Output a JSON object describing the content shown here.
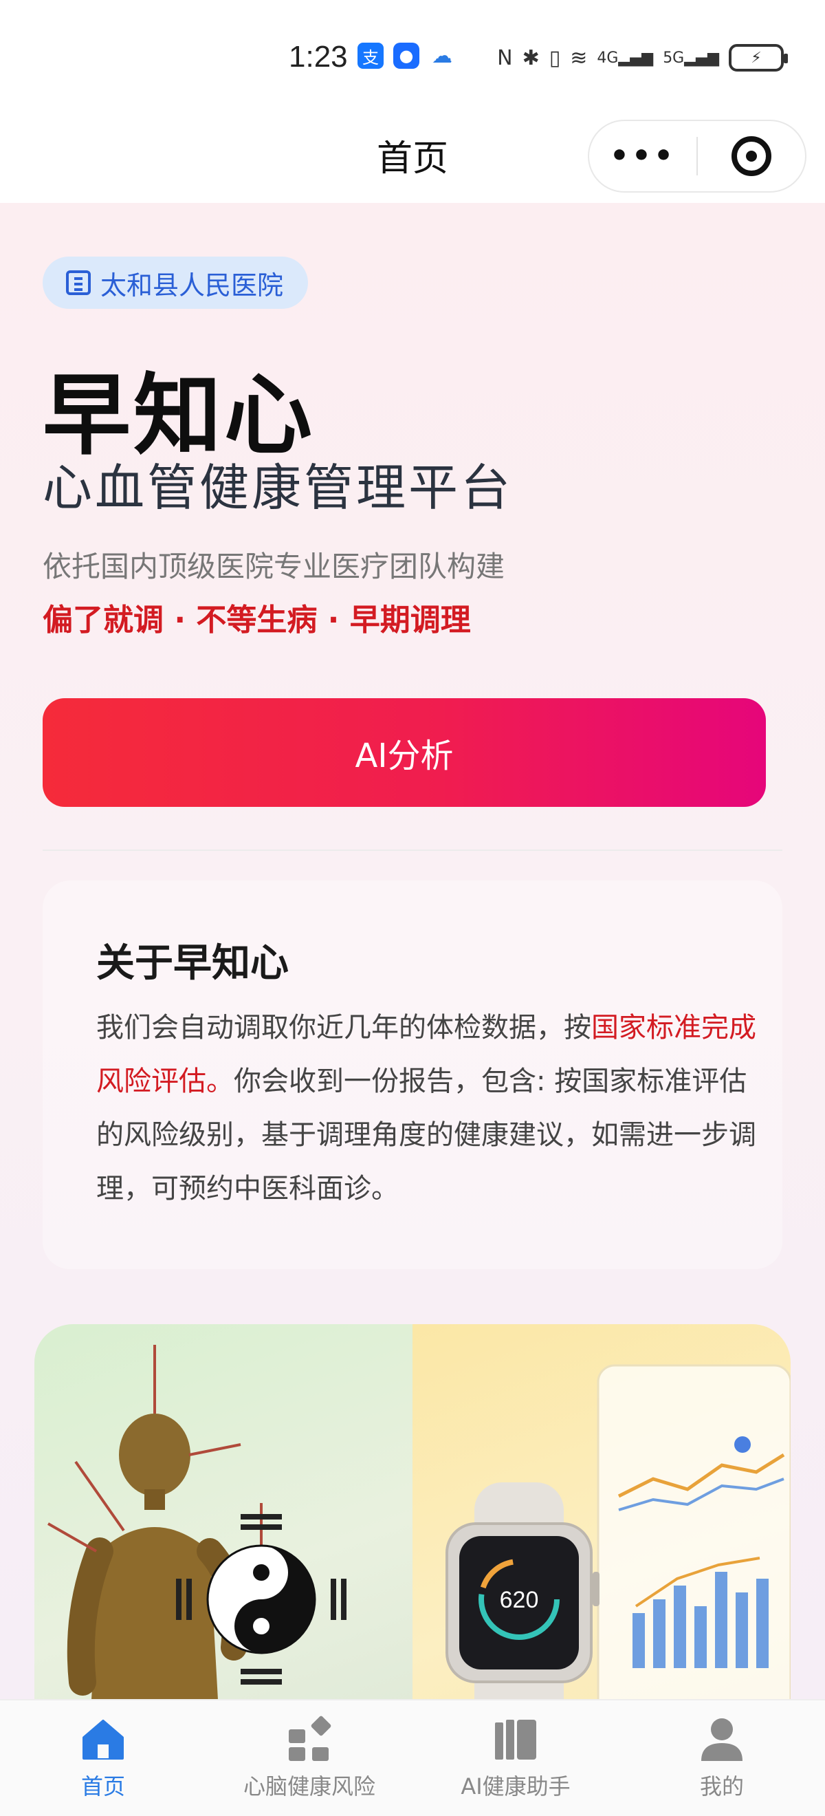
{
  "status": {
    "time": "1:23",
    "network": "4G",
    "network2": "5G"
  },
  "header": {
    "title": "首页",
    "more_icon": "ellipsis-icon",
    "close_icon": "target-icon"
  },
  "hospital": {
    "name": "太和县人民医院",
    "icon": "hospital-icon"
  },
  "hero": {
    "title": "早知心",
    "subtitle": "心血管健康管理平台",
    "description": "依托国内顶级医院专业医疗团队构建",
    "slogan": "偏了就调 · 不等生病 · 早期调理",
    "button_label": "AI分析"
  },
  "about": {
    "title": "关于早知心",
    "body_pre": "我们会自动调取你近几年的体检数据，按",
    "body_highlight": "国家标准完成风险评估。",
    "body_post": "你会收到一份报告，包含: 按国家标准评估的风险级别，基于调理角度的健康建议，如需进一步调理，可预约中医科面诊。"
  },
  "banner": {
    "watch_reading": "620"
  },
  "tabbar": {
    "items": [
      {
        "label": "首页",
        "icon": "home-icon",
        "active": true
      },
      {
        "label": "心脑健康风险",
        "icon": "grid-icon",
        "active": false
      },
      {
        "label": "AI健康助手",
        "icon": "book-icon",
        "active": false
      },
      {
        "label": "我的",
        "icon": "user-icon",
        "active": false
      }
    ]
  },
  "colors": {
    "accent_red": "#d31b22",
    "accent_blue": "#2a7be4",
    "button_gradient_start": "#f52b3a",
    "button_gradient_end": "#e6067a"
  }
}
